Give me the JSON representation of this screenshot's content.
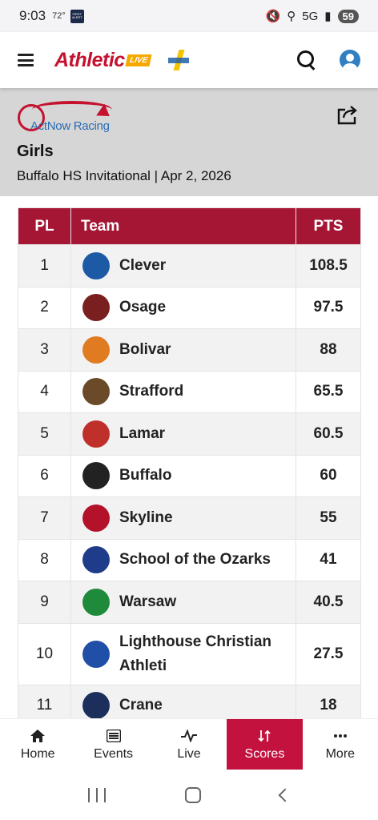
{
  "status_bar": {
    "time": "9:03",
    "temp": "72°",
    "alert_badge": "FIRST ALERT",
    "network": "5G",
    "battery": "59"
  },
  "header": {
    "logo_text": "Athletic",
    "logo_badge": "LIVE"
  },
  "banner": {
    "sponsor": "ActNow Racing",
    "gender": "Girls",
    "meet": "Buffalo HS Invitational | Apr 2, 2026"
  },
  "table": {
    "headers": {
      "place": "PL",
      "team": "Team",
      "points": "PTS"
    },
    "rows": [
      {
        "pl": "1",
        "team": "Clever",
        "pts": "108.5"
      },
      {
        "pl": "2",
        "team": "Osage",
        "pts": "97.5"
      },
      {
        "pl": "3",
        "team": "Bolivar",
        "pts": "88"
      },
      {
        "pl": "4",
        "team": "Strafford",
        "pts": "65.5"
      },
      {
        "pl": "5",
        "team": "Lamar",
        "pts": "60.5"
      },
      {
        "pl": "6",
        "team": "Buffalo",
        "pts": "60"
      },
      {
        "pl": "7",
        "team": "Skyline",
        "pts": "55"
      },
      {
        "pl": "8",
        "team": "School of the Ozarks",
        "pts": "41"
      },
      {
        "pl": "9",
        "team": "Warsaw",
        "pts": "40.5"
      },
      {
        "pl": "10",
        "team": "Lighthouse Christian Athleti",
        "pts": "27.5"
      },
      {
        "pl": "11",
        "team": "Crane",
        "pts": "18"
      }
    ],
    "logo_colors": [
      "#1c5aa6",
      "#7a1f1f",
      "#e07b22",
      "#6b4a2a",
      "#c0302a",
      "#222222",
      "#b3122a",
      "#1f3c8a",
      "#1f8a3a",
      "#1f4fa6",
      "#1c2f5c"
    ]
  },
  "bottom_nav": {
    "items": [
      {
        "label": "Home",
        "icon": "home-icon"
      },
      {
        "label": "Events",
        "icon": "list-icon"
      },
      {
        "label": "Live",
        "icon": "pulse-icon"
      },
      {
        "label": "Scores",
        "icon": "sort-icon"
      },
      {
        "label": "More",
        "icon": "more-dots-icon"
      }
    ],
    "active": "Scores",
    "active_color": "#c4123f"
  },
  "colors": {
    "brand_red": "#c4122f",
    "table_header": "#a51635",
    "banner_bg": "#d6d6d6"
  }
}
